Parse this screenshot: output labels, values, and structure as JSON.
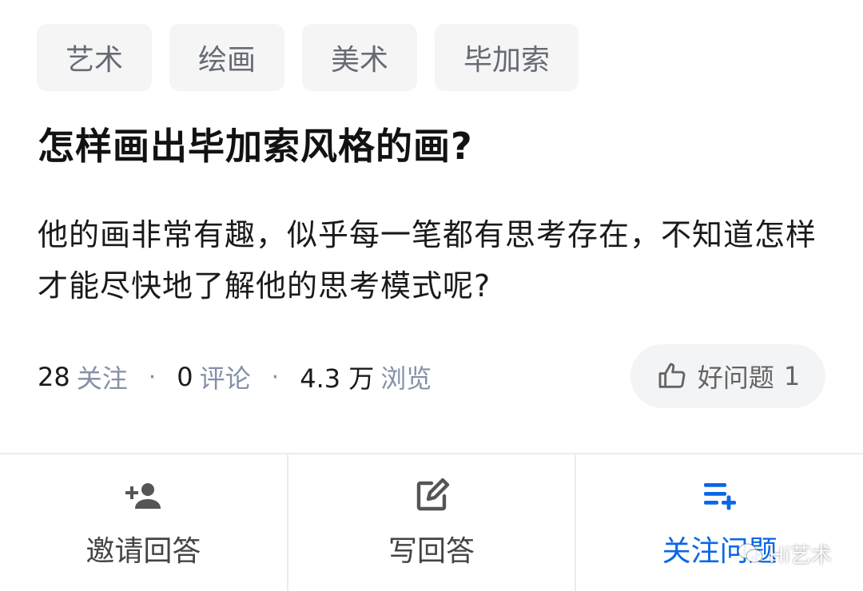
{
  "tags": [
    "艺术",
    "绘画",
    "美术",
    "毕加索"
  ],
  "question": {
    "title": "怎样画出毕加索风格的画?",
    "detail": "他的画非常有趣，似乎每一笔都有思考存在，不知道怎样才能尽快地了解他的思考模式呢?"
  },
  "stats": {
    "followers_num": "28",
    "followers_label": "关注",
    "comments_num": "0",
    "comments_label": "评论",
    "views_num": "4.3 万",
    "views_label": "浏览",
    "separator": "·"
  },
  "good_question": {
    "label": "好问题",
    "count": "1",
    "icon": "thumbs-up-icon"
  },
  "actions": {
    "invite": {
      "label": "邀请回答",
      "icon": "add-person-icon"
    },
    "write": {
      "label": "写回答",
      "icon": "edit-icon"
    },
    "follow": {
      "label": "关注问题",
      "icon": "playlist-add-icon"
    }
  },
  "watermark": {
    "text": "Hi艺术",
    "icon": "wechat-icon"
  },
  "colors": {
    "accent": "#0a66e6",
    "tag_bg": "#f5f5f6",
    "muted": "#8590a6"
  }
}
